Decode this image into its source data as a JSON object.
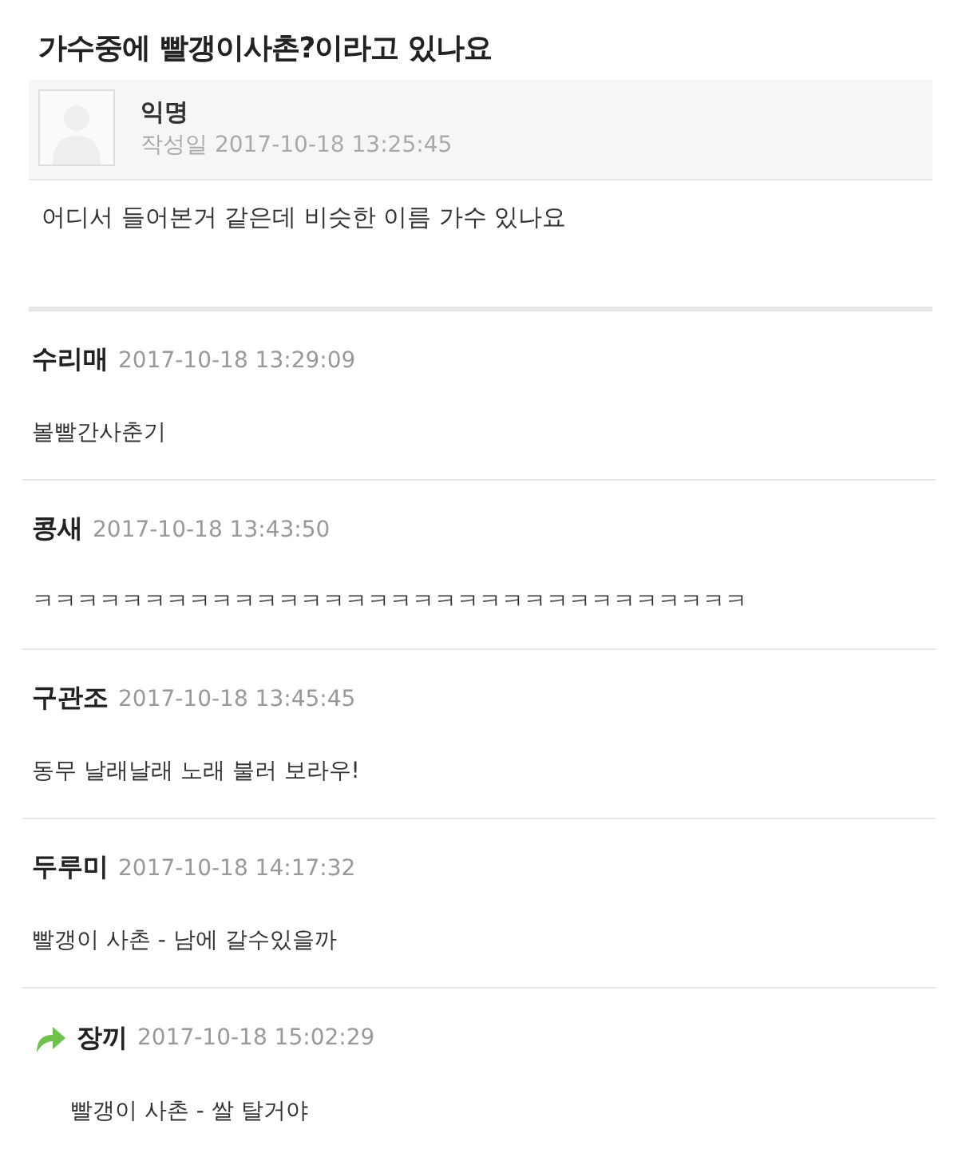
{
  "title": "가수중에 빨갱이사촌?이라고 있나요",
  "post": {
    "author": "익명",
    "date_label": "작성일",
    "date": "2017-10-18 13:25:45",
    "body": "어디서 들어본거 같은데 비슷한 이름 가수 있나요"
  },
  "comments": [
    {
      "author": "수리매",
      "date": "2017-10-18 13:29:09",
      "body": "볼빨간사춘기",
      "reply": false
    },
    {
      "author": "콩새",
      "date": "2017-10-18 13:43:50",
      "body": "ㅋㅋㅋㅋㅋㅋㅋㅋㅋㅋㅋㅋㅋㅋㅋㅋㅋㅋㅋㅋㅋㅋㅋㅋㅋㅋㅋㅋㅋㅋㅋㅋ",
      "reply": false
    },
    {
      "author": "구관조",
      "date": "2017-10-18 13:45:45",
      "body": "동무 날래날래 노래 불러 보라우!",
      "reply": false
    },
    {
      "author": "두루미",
      "date": "2017-10-18 14:17:32",
      "body": "빨갱이 사촌 - 남에 갈수있을까",
      "reply": false
    },
    {
      "author": "장끼",
      "date": "2017-10-18 15:02:29",
      "body": "빨갱이 사촌 - 쌀 탈거야",
      "reply": true
    }
  ]
}
